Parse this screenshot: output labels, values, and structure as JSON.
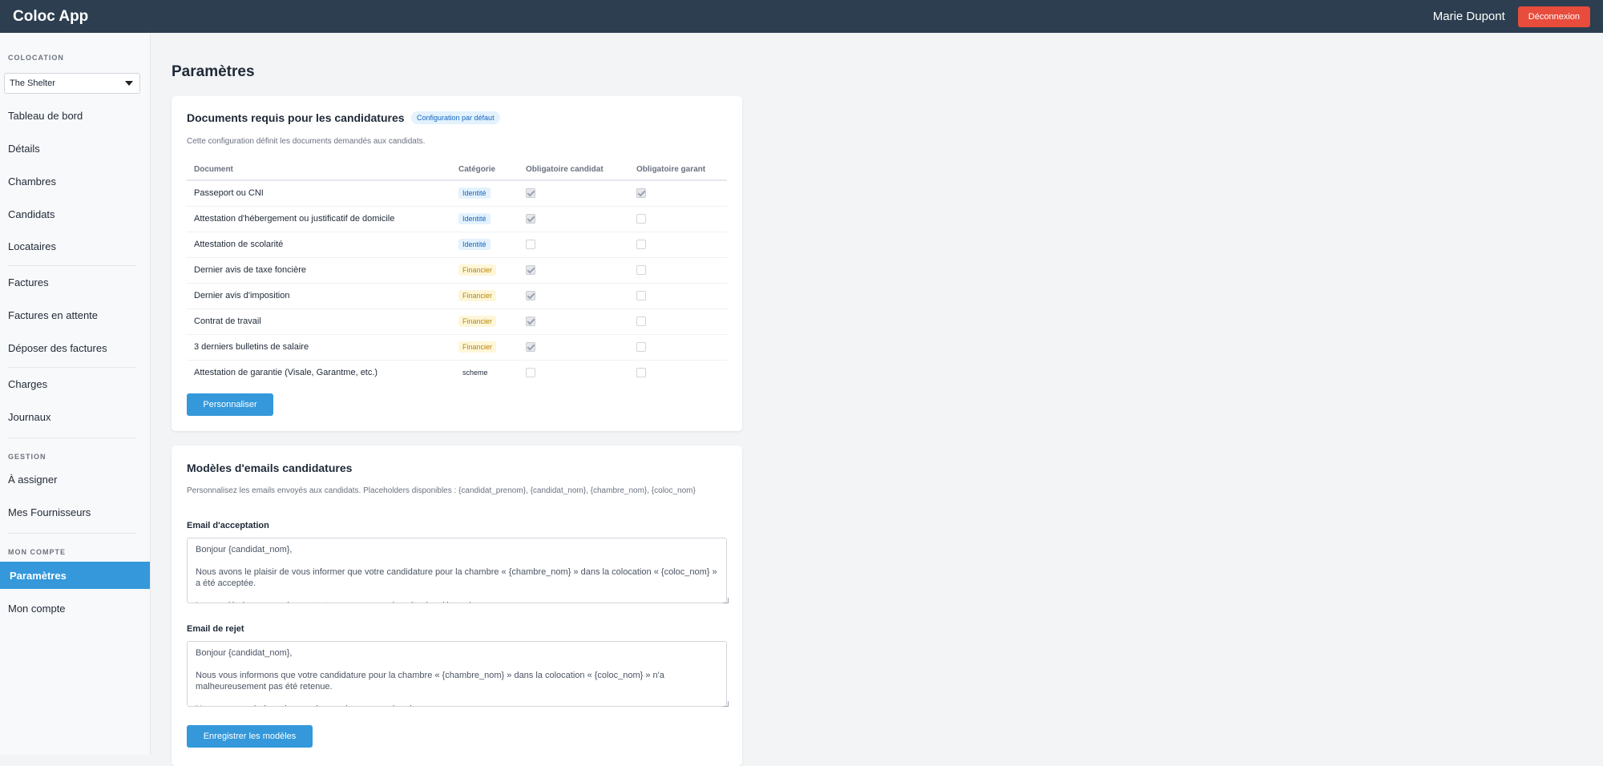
{
  "app": {
    "title": "Coloc App"
  },
  "header": {
    "user_name": "Marie Dupont",
    "logout_label": "Déconnexion"
  },
  "sidebar": {
    "coloc_section_label": "COLOCATION",
    "coloc_select_value": "The Shelter",
    "group1": [
      "Tableau de bord",
      "Détails",
      "Chambres",
      "Candidats",
      "Locataires"
    ],
    "group2": [
      "Factures",
      "Factures en attente",
      "Déposer des factures"
    ],
    "group3": [
      "Charges",
      "Journaux"
    ],
    "gestion_label": "GESTION",
    "gestion_items": [
      "À assigner",
      "Mes Fournisseurs"
    ],
    "account_label": "MON COMPTE",
    "account_items": [
      "Paramètres",
      "Mon compte"
    ]
  },
  "page": {
    "title": "Paramètres"
  },
  "documents_card": {
    "title": "Documents requis pour les candidatures",
    "badge": "Configuration par défaut",
    "description": "Cette configuration définit les documents demandés aux candidats.",
    "columns": [
      "Document",
      "Catégorie",
      "Obligatoire candidat",
      "Obligatoire garant"
    ],
    "rows": [
      {
        "document": "Passeport ou CNI",
        "category": "Identité",
        "cat_type": "identite",
        "candidat": true,
        "garant": true
      },
      {
        "document": "Attestation d'hébergement ou justificatif de domicile",
        "category": "Identité",
        "cat_type": "identite",
        "candidat": true,
        "garant": false
      },
      {
        "document": "Attestation de scolarité",
        "category": "Identité",
        "cat_type": "identite",
        "candidat": false,
        "garant": false
      },
      {
        "document": "Dernier avis de taxe foncière",
        "category": "Financier",
        "cat_type": "financier",
        "candidat": true,
        "garant": false
      },
      {
        "document": "Dernier avis d'imposition",
        "category": "Financier",
        "cat_type": "financier",
        "candidat": true,
        "garant": false
      },
      {
        "document": "Contrat de travail",
        "category": "Financier",
        "cat_type": "financier",
        "candidat": true,
        "garant": false
      },
      {
        "document": "3 derniers bulletins de salaire",
        "category": "Financier",
        "cat_type": "financier",
        "candidat": true,
        "garant": false
      },
      {
        "document": "Attestation de garantie (Visale, Garantme, etc.)",
        "category": "scheme",
        "cat_type": "scheme",
        "candidat": false,
        "garant": false
      }
    ],
    "customize_label": "Personnaliser"
  },
  "emails_card": {
    "title": "Modèles d'emails candidatures",
    "description": "Personnalisez les emails envoyés aux candidats. Placeholders disponibles : {candidat_prenom}, {candidat_nom}, {chambre_nom}, {coloc_nom}",
    "acceptance_label": "Email d'acceptation",
    "acceptance_text": "Bonjour {candidat_nom},\n\nNous avons le plaisir de vous informer que votre candidature pour la chambre « {chambre_nom} » dans la colocation « {coloc_nom} » a été acceptée.\n\nLe propriétaire va prendre contact avec vous pour la suite des démarches.",
    "rejection_label": "Email de rejet",
    "rejection_text": "Bonjour {candidat_nom},\n\nNous vous informons que votre candidature pour la chambre « {chambre_nom} » dans la colocation « {coloc_nom} » n'a malheureusement pas été retenue.\n\nNous vous souhaitons bonne chance dans vos recherches.",
    "save_label": "Enregistrer les modèles"
  }
}
